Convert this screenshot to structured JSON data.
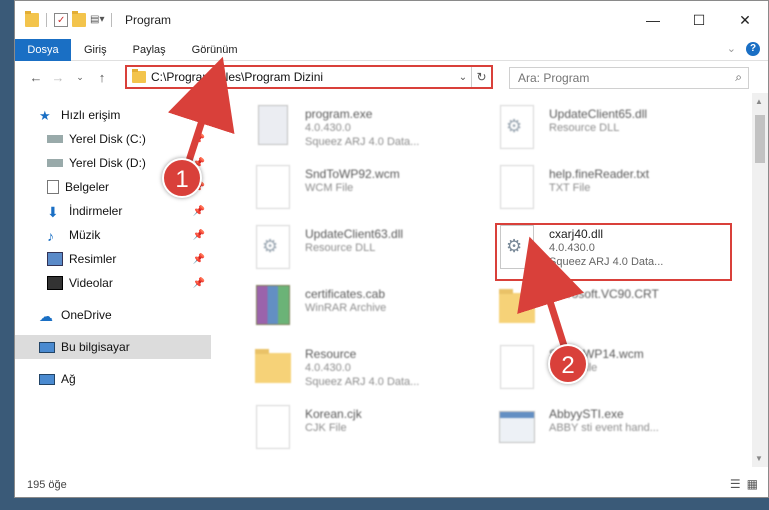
{
  "window": {
    "title": "Program",
    "controls": [
      "minimize",
      "maximize",
      "close"
    ]
  },
  "ribbon": {
    "tabs": [
      {
        "label": "Dosya",
        "active": true
      },
      {
        "label": "Giriş"
      },
      {
        "label": "Paylaş"
      },
      {
        "label": "Görünüm"
      }
    ],
    "help": "?"
  },
  "navigation": {
    "address": "C:\\Program Files\\Program Dizini",
    "search_placeholder": "Ara: Program"
  },
  "nav_pane": {
    "items": [
      {
        "label": "Hızlı erişim",
        "icon": "star-icon",
        "color": "#1a6fc4"
      },
      {
        "label": "Yerel Disk (C:)",
        "icon": "drive-icon",
        "pinned": true
      },
      {
        "label": "Yerel Disk (D:)",
        "icon": "drive-icon",
        "pinned": true
      },
      {
        "label": "Belgeler",
        "icon": "documents-icon",
        "pinned": true
      },
      {
        "label": "İndirmeler",
        "icon": "download-icon",
        "pinned": true
      },
      {
        "label": "Müzik",
        "icon": "music-icon",
        "pinned": true
      },
      {
        "label": "Resimler",
        "icon": "pictures-icon",
        "pinned": true
      },
      {
        "label": "Videolar",
        "icon": "videos-icon",
        "pinned": true
      },
      {
        "label": "OneDrive",
        "icon": "cloud-icon"
      },
      {
        "label": "Bu bilgisayar",
        "icon": "computer-icon",
        "selected": true
      },
      {
        "label": "Ağ",
        "icon": "network-icon"
      }
    ]
  },
  "files": [
    {
      "name": "program.exe",
      "line2": "4.0.430.0",
      "line3": "Squeez ARJ 4.0 Data...",
      "icon": "exe-icon"
    },
    {
      "name": "UpdateClient65.dll",
      "line2": "Resource DLL",
      "line3": "",
      "icon": "dll-icon"
    },
    {
      "name": "SndToWP92.wcm",
      "line2": "WCM File",
      "line3": "",
      "icon": "file-icon"
    },
    {
      "name": "help.fineReader.txt",
      "line2": "TXT File",
      "line3": "",
      "icon": "file-icon"
    },
    {
      "name": "UpdateClient63.dll",
      "line2": "Resource DLL",
      "line3": "",
      "icon": "dll-icon"
    },
    {
      "name": "cxarj40.dll",
      "line2": "4.0.430.0",
      "line3": "Squeez ARJ 4.0 Data...",
      "icon": "dll-icon",
      "highlighted": true
    },
    {
      "name": "certificates.cab",
      "line2": "WinRAR Archive",
      "line3": "",
      "icon": "winrar-icon"
    },
    {
      "name": "Microsoft.VC90.CRT",
      "line2": "",
      "line3": "",
      "icon": "folder-icon"
    },
    {
      "name": "Resource",
      "line2": "4.0.430.0",
      "line3": "Squeez ARJ 4.0 Data...",
      "icon": "folder-icon"
    },
    {
      "name": "SndToWP14.wcm",
      "line2": "WCM File",
      "line3": "",
      "icon": "file-icon"
    },
    {
      "name": "Korean.cjk",
      "line2": "CJK File",
      "line3": "",
      "icon": "file-icon"
    },
    {
      "name": "AbbyySTI.exe",
      "line2": "ABBY sti event hand...",
      "line3": "",
      "icon": "app-icon"
    }
  ],
  "status": {
    "count": "195 öğe"
  },
  "annotations": {
    "step1": "1",
    "step2": "2",
    "color": "#d9403a"
  }
}
